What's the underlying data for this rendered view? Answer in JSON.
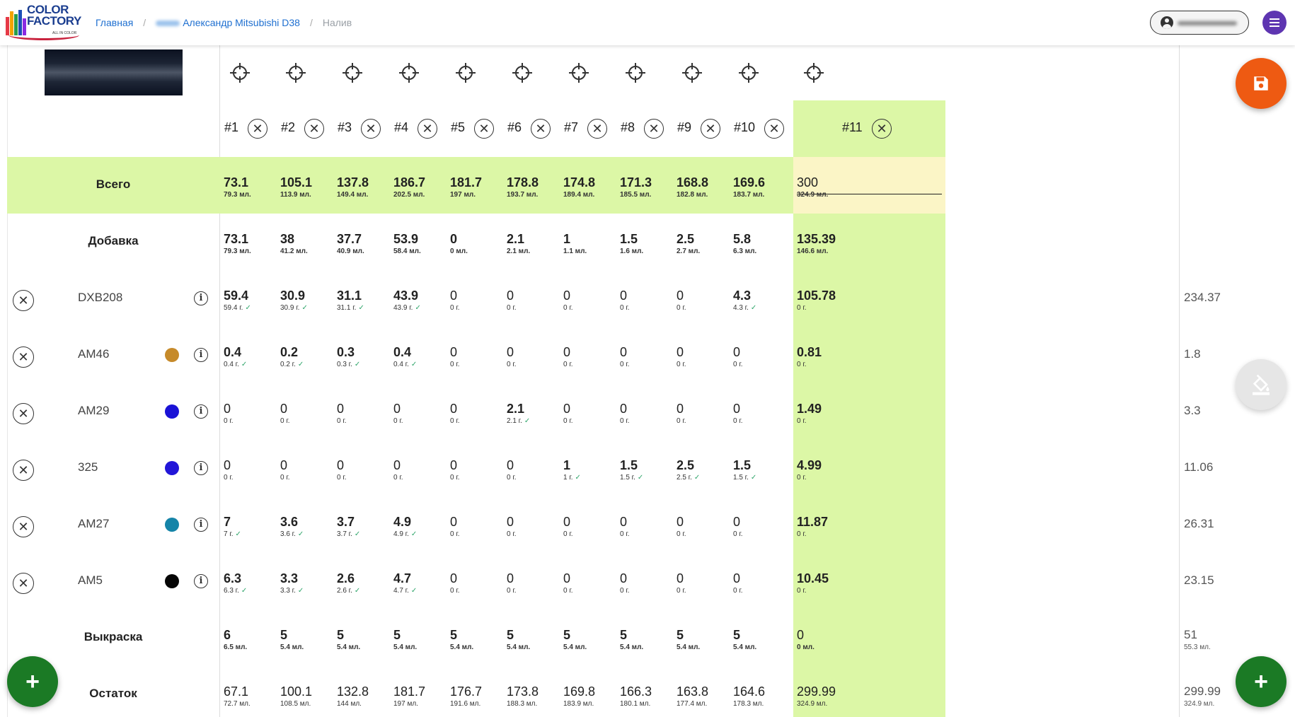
{
  "header": {
    "logo_text": [
      "COLOR",
      "FACTORY"
    ],
    "logo_sub": "ALL IN COLOR",
    "breadcrumb": {
      "home": "Главная",
      "separator": "/",
      "project": "Александр Mitsubishi D38",
      "current": "Налив"
    }
  },
  "columns": [
    "#1",
    "#2",
    "#3",
    "#4",
    "#5",
    "#6",
    "#7",
    "#8",
    "#9",
    "#10",
    "#11"
  ],
  "rows": {
    "total": {
      "label": "Всего",
      "cells": [
        {
          "v": "73.1",
          "s": "79.3 мл."
        },
        {
          "v": "105.1",
          "s": "113.9 мл."
        },
        {
          "v": "137.8",
          "s": "149.4 мл."
        },
        {
          "v": "186.7",
          "s": "202.5 мл."
        },
        {
          "v": "181.7",
          "s": "197 мл."
        },
        {
          "v": "178.8",
          "s": "193.7 мл."
        },
        {
          "v": "174.8",
          "s": "189.4 мл."
        },
        {
          "v": "171.3",
          "s": "185.5 мл."
        },
        {
          "v": "168.8",
          "s": "182.8 мл."
        },
        {
          "v": "169.6",
          "s": "183.7 мл."
        }
      ],
      "input_value": "300",
      "input_sub": "324.9 мл."
    },
    "additive": {
      "label": "Добавка",
      "cells": [
        {
          "v": "73.1",
          "s": "79.3 мл."
        },
        {
          "v": "38",
          "s": "41.2 мл."
        },
        {
          "v": "37.7",
          "s": "40.9 мл."
        },
        {
          "v": "53.9",
          "s": "58.4 мл."
        },
        {
          "v": "0",
          "s": "0 мл."
        },
        {
          "v": "2.1",
          "s": "2.1 мл."
        },
        {
          "v": "1",
          "s": "1.1 мл."
        },
        {
          "v": "1.5",
          "s": "1.6 мл."
        },
        {
          "v": "2.5",
          "s": "2.7 мл."
        },
        {
          "v": "5.8",
          "s": "6.3 мл."
        },
        {
          "v": "135.39",
          "s": "146.6 мл."
        }
      ]
    },
    "components": [
      {
        "name": "DXB208",
        "dot": null,
        "right": "234.37",
        "cells": [
          {
            "v": "59.4",
            "s": "59.4 г.",
            "ok": true
          },
          {
            "v": "30.9",
            "s": "30.9 г.",
            "ok": true
          },
          {
            "v": "31.1",
            "s": "31.1 г.",
            "ok": true
          },
          {
            "v": "43.9",
            "s": "43.9 г.",
            "ok": true
          },
          {
            "v": "0",
            "s": "0 г."
          },
          {
            "v": "0",
            "s": "0 г."
          },
          {
            "v": "0",
            "s": "0 г."
          },
          {
            "v": "0",
            "s": "0 г."
          },
          {
            "v": "0",
            "s": "0 г."
          },
          {
            "v": "4.3",
            "s": "4.3 г.",
            "ok": true
          },
          {
            "v": "105.78",
            "s": "0 г."
          }
        ]
      },
      {
        "name": "AM46",
        "dot": "#c68a2a",
        "right": "1.8",
        "cells": [
          {
            "v": "0.4",
            "s": "0.4 г.",
            "ok": true
          },
          {
            "v": "0.2",
            "s": "0.2 г.",
            "ok": true
          },
          {
            "v": "0.3",
            "s": "0.3 г.",
            "ok": true
          },
          {
            "v": "0.4",
            "s": "0.4 г.",
            "ok": true
          },
          {
            "v": "0",
            "s": "0 г."
          },
          {
            "v": "0",
            "s": "0 г."
          },
          {
            "v": "0",
            "s": "0 г."
          },
          {
            "v": "0",
            "s": "0 г."
          },
          {
            "v": "0",
            "s": "0 г."
          },
          {
            "v": "0",
            "s": "0 г."
          },
          {
            "v": "0.81",
            "s": "0 г."
          }
        ]
      },
      {
        "name": "AM29",
        "dot": "#1a12d6",
        "right": "3.3",
        "cells": [
          {
            "v": "0",
            "s": "0 г."
          },
          {
            "v": "0",
            "s": "0 г."
          },
          {
            "v": "0",
            "s": "0 г."
          },
          {
            "v": "0",
            "s": "0 г."
          },
          {
            "v": "0",
            "s": "0 г."
          },
          {
            "v": "2.1",
            "s": "2.1 г.",
            "ok": true
          },
          {
            "v": "0",
            "s": "0 г."
          },
          {
            "v": "0",
            "s": "0 г."
          },
          {
            "v": "0",
            "s": "0 г."
          },
          {
            "v": "0",
            "s": "0 г."
          },
          {
            "v": "1.49",
            "s": "0 г."
          }
        ]
      },
      {
        "name": "325",
        "dot": "#2216d8",
        "right": "11.06",
        "cells": [
          {
            "v": "0",
            "s": "0 г."
          },
          {
            "v": "0",
            "s": "0 г."
          },
          {
            "v": "0",
            "s": "0 г."
          },
          {
            "v": "0",
            "s": "0 г."
          },
          {
            "v": "0",
            "s": "0 г."
          },
          {
            "v": "0",
            "s": "0 г."
          },
          {
            "v": "1",
            "s": "1 г.",
            "ok": true
          },
          {
            "v": "1.5",
            "s": "1.5 г.",
            "ok": true
          },
          {
            "v": "2.5",
            "s": "2.5 г.",
            "ok": true
          },
          {
            "v": "1.5",
            "s": "1.5 г.",
            "ok": true
          },
          {
            "v": "4.99",
            "s": "0 г."
          }
        ]
      },
      {
        "name": "AM27",
        "dot": "#1584a8",
        "right": "26.31",
        "cells": [
          {
            "v": "7",
            "s": "7 г.",
            "ok": true
          },
          {
            "v": "3.6",
            "s": "3.6 г.",
            "ok": true
          },
          {
            "v": "3.7",
            "s": "3.7 г.",
            "ok": true
          },
          {
            "v": "4.9",
            "s": "4.9 г.",
            "ok": true
          },
          {
            "v": "0",
            "s": "0 г."
          },
          {
            "v": "0",
            "s": "0 г."
          },
          {
            "v": "0",
            "s": "0 г."
          },
          {
            "v": "0",
            "s": "0 г."
          },
          {
            "v": "0",
            "s": "0 г."
          },
          {
            "v": "0",
            "s": "0 г."
          },
          {
            "v": "11.87",
            "s": "0 г."
          }
        ]
      },
      {
        "name": "AM5",
        "dot": "#050505",
        "right": "23.15",
        "cells": [
          {
            "v": "6.3",
            "s": "6.3 г.",
            "ok": true
          },
          {
            "v": "3.3",
            "s": "3.3 г.",
            "ok": true
          },
          {
            "v": "2.6",
            "s": "2.6 г.",
            "ok": true
          },
          {
            "v": "4.7",
            "s": "4.7 г.",
            "ok": true
          },
          {
            "v": "0",
            "s": "0 г."
          },
          {
            "v": "0",
            "s": "0 г."
          },
          {
            "v": "0",
            "s": "0 г."
          },
          {
            "v": "0",
            "s": "0 г."
          },
          {
            "v": "0",
            "s": "0 г."
          },
          {
            "v": "0",
            "s": "0 г."
          },
          {
            "v": "10.45",
            "s": "0 г."
          }
        ]
      }
    ],
    "spray": {
      "label": "Выкраска",
      "cells": [
        {
          "v": "6",
          "s": "6.5 мл."
        },
        {
          "v": "5",
          "s": "5.4 мл."
        },
        {
          "v": "5",
          "s": "5.4 мл."
        },
        {
          "v": "5",
          "s": "5.4 мл."
        },
        {
          "v": "5",
          "s": "5.4 мл."
        },
        {
          "v": "5",
          "s": "5.4 мл."
        },
        {
          "v": "5",
          "s": "5.4 мл."
        },
        {
          "v": "5",
          "s": "5.4 мл."
        },
        {
          "v": "5",
          "s": "5.4 мл."
        },
        {
          "v": "5",
          "s": "5.4 мл."
        },
        {
          "v": "0",
          "s": "0 мл."
        }
      ],
      "right": {
        "v": "51",
        "s": "55.3 мл."
      }
    },
    "remainder": {
      "label": "Остаток",
      "cells": [
        {
          "v": "67.1",
          "s": "72.7 мл."
        },
        {
          "v": "100.1",
          "s": "108.5 мл."
        },
        {
          "v": "132.8",
          "s": "144 мл."
        },
        {
          "v": "181.7",
          "s": "197 мл."
        },
        {
          "v": "176.7",
          "s": "191.6 мл."
        },
        {
          "v": "173.8",
          "s": "188.3 мл."
        },
        {
          "v": "169.8",
          "s": "183.9 мл."
        },
        {
          "v": "166.3",
          "s": "180.1 мл."
        },
        {
          "v": "163.8",
          "s": "177.4 мл."
        },
        {
          "v": "164.6",
          "s": "178.3 мл."
        },
        {
          "v": "299.99",
          "s": "324.9 мл."
        }
      ],
      "right": {
        "v": "299.99",
        "s": "324.9 мл."
      }
    }
  },
  "icons": {
    "target": "crosshair-icon",
    "remove": "close-circle-icon",
    "info": "info-icon",
    "save": "floppy-disk-icon",
    "paint": "paint-bucket-icon",
    "add": "plus-icon",
    "menu": "hamburger-menu-icon",
    "user": "user-avatar-icon"
  },
  "colors": {
    "accent_green": "#dcf7a6",
    "input_yellow": "#fbf5c6",
    "save_orange": "#ee5a12",
    "add_green": "#1b7a25",
    "menu_purple": "#5e35b1",
    "link_blue": "#1e6fd0",
    "check_green": "#2ea56a"
  }
}
